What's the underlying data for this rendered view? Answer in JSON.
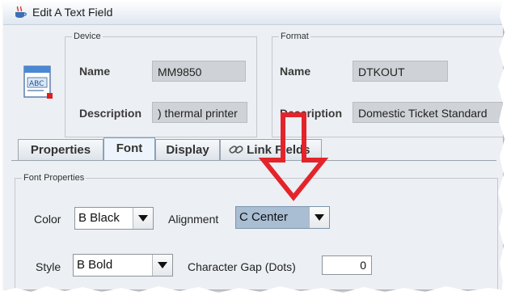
{
  "window": {
    "title": "Edit A Text Field"
  },
  "device": {
    "group_label": "Device",
    "name_label": "Name",
    "name_value": "MM9850",
    "description_label": "Description",
    "description_value": ") thermal printer"
  },
  "format": {
    "group_label": "Format",
    "name_label": "Name",
    "name_value": "DTKOUT",
    "description_label": "Description",
    "description_value": "Domestic Ticket Standard"
  },
  "tabs": [
    {
      "label": "Properties"
    },
    {
      "label": "Font"
    },
    {
      "label": "Display"
    },
    {
      "label": "Link Fields"
    }
  ],
  "font_properties": {
    "group_label": "Font Properties",
    "color_label": "Color",
    "color_value": "B Black",
    "alignment_label": "Alignment",
    "alignment_value": "C Center",
    "style_label": "Style",
    "style_value": "B Bold",
    "char_gap_label": "Character Gap (Dots)",
    "char_gap_value": "0"
  },
  "colors": {
    "annotation_arrow": "#e3242b",
    "alignment_highlight": "#a9bdd3",
    "active_tab": "#eef4fb"
  },
  "icons": {
    "title": "java-cup-icon",
    "document": "text-field-document-icon",
    "link_tab": "chain-link-icon",
    "dropdown": "triangle-down-icon",
    "annotation": "red-down-arrow-icon"
  }
}
